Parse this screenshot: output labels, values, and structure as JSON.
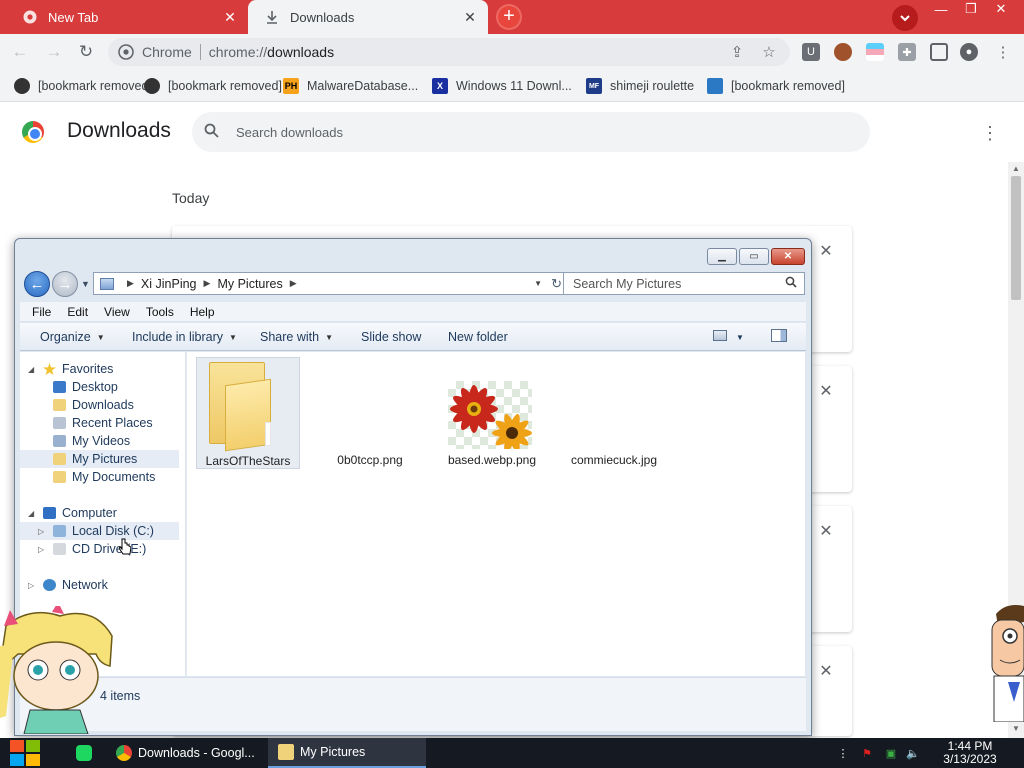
{
  "browser": {
    "tabs": [
      {
        "title": "New Tab",
        "active": false
      },
      {
        "title": "Downloads",
        "active": true
      }
    ],
    "new_tab_symbol": "+",
    "omnibox": {
      "site_label": "Chrome",
      "url_scheme": "chrome://",
      "url_path": "downloads"
    },
    "bookmarks": [
      {
        "label": "[bookmark removed]",
        "icon": "github-cat-icon"
      },
      {
        "label": "[bookmark removed]",
        "icon": "globe-icon"
      },
      {
        "label": "MalwareDatabase...",
        "icon": "ph-icon",
        "icon_text": "PH"
      },
      {
        "label": "Windows 11 Downl...",
        "icon": "x-icon",
        "icon_text": "X"
      },
      {
        "label": "shimeji roulette",
        "icon": "mft-icon",
        "icon_text": "MF"
      },
      {
        "label": "[bookmark removed]",
        "icon": "app-icon"
      }
    ],
    "accent_color": "#d83b3b"
  },
  "downloads_page": {
    "title": "Downloads",
    "search_placeholder": "Search downloads",
    "section": "Today",
    "item_count_visible": 4
  },
  "explorer": {
    "breadcrumb": [
      "Xi JinPing",
      "My Pictures"
    ],
    "search_placeholder": "Search My Pictures",
    "menu": [
      "File",
      "Edit",
      "View",
      "Tools",
      "Help"
    ],
    "commands": {
      "organize": "Organize",
      "include": "Include in library",
      "share": "Share with",
      "slideshow": "Slide show",
      "new_folder": "New folder"
    },
    "nav": {
      "favorites": "Favorites",
      "favorites_items": [
        "Desktop",
        "Downloads",
        "Recent Places",
        "My Videos",
        "My Pictures",
        "My Documents"
      ],
      "selected": "My Pictures",
      "computer": "Computer",
      "computer_items": [
        "Local Disk (C:)",
        "CD Drive (E:)"
      ],
      "network": "Network"
    },
    "files": [
      {
        "name": "LarsOfTheStars",
        "type": "folder"
      },
      {
        "name": "0b0tccp.png",
        "type": "image"
      },
      {
        "name": "based.webp.png",
        "type": "image"
      },
      {
        "name": "commiecuck.jpg",
        "type": "image"
      }
    ],
    "status": "4 items"
  },
  "taskbar": {
    "buttons": [
      {
        "label": "Downloads - Googl...",
        "icon": "chrome-icon"
      },
      {
        "label": "My Pictures",
        "icon": "folder-icon"
      }
    ],
    "time": "1:44 PM",
    "date": "3/13/2023"
  }
}
